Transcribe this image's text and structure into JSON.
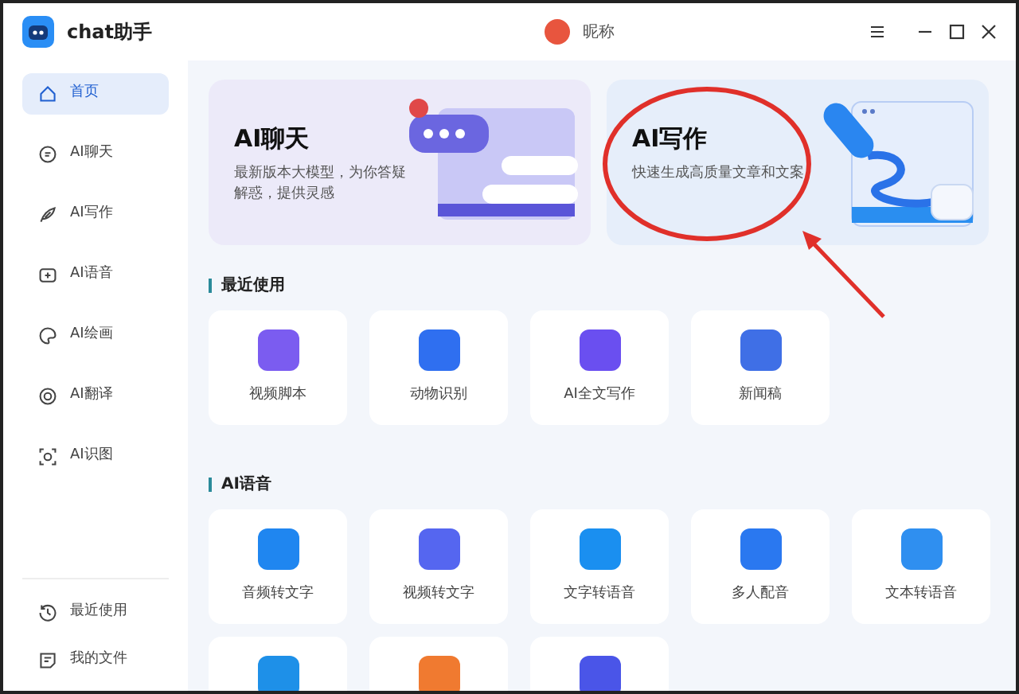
{
  "window": {
    "title": "chat助手",
    "user_name": "昵称"
  },
  "sidebar": {
    "items": [
      {
        "label": "首页",
        "selected": true
      },
      {
        "label": "AI聊天",
        "selected": false
      },
      {
        "label": "AI写作",
        "selected": false
      },
      {
        "label": "AI语音",
        "selected": false
      },
      {
        "label": "AI绘画",
        "selected": false
      },
      {
        "label": "AI翻译",
        "selected": false
      },
      {
        "label": "AI识图",
        "selected": false
      }
    ],
    "bottom_items": [
      {
        "label": "最近使用"
      },
      {
        "label": "我的文件"
      }
    ]
  },
  "banners": [
    {
      "title": "AI聊天",
      "description": "最新版本大模型，为你答疑解惑，提供灵感"
    },
    {
      "title": "AI写作",
      "description": "快速生成高质量文章和文案"
    }
  ],
  "sections": [
    {
      "title": "最近使用",
      "tiles": [
        {
          "label": "视频脚本",
          "color": "#7b5cf0"
        },
        {
          "label": "动物识别",
          "color": "#2f6ff0"
        },
        {
          "label": "AI全文写作",
          "color": "#6a4ff0"
        },
        {
          "label": "新闻稿",
          "color": "#3f6fe6"
        }
      ]
    },
    {
      "title": "AI语音",
      "tiles": [
        {
          "label": "音频转文字",
          "color": "#1f86f0"
        },
        {
          "label": "视频转文字",
          "color": "#5566f0"
        },
        {
          "label": "文字转语音",
          "color": "#1a8ff0"
        },
        {
          "label": "多人配音",
          "color": "#2a78f0"
        },
        {
          "label": "文本转语音",
          "color": "#2f8ff0"
        },
        {
          "color": "#1e90e8"
        },
        {
          "color": "#f07a30"
        },
        {
          "color": "#4a55e8"
        }
      ]
    }
  ]
}
